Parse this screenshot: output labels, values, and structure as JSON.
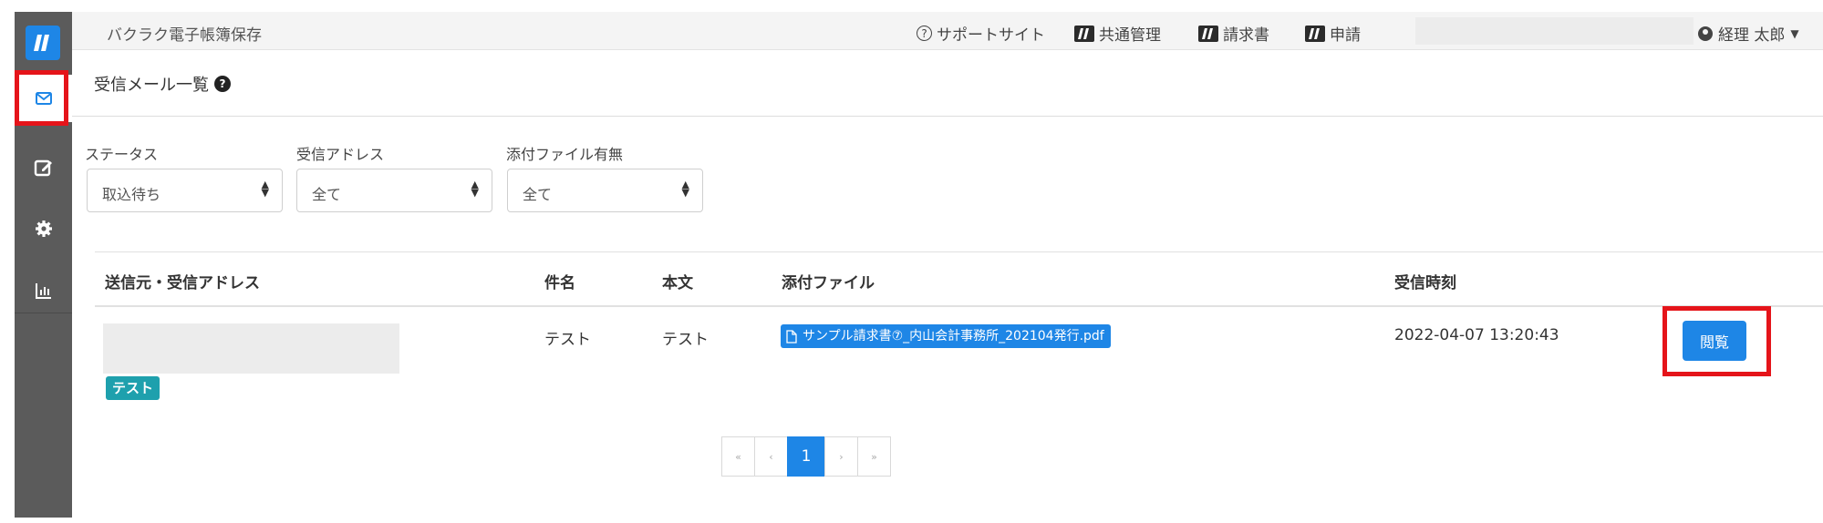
{
  "header": {
    "app_title": "バクラク電子帳簿保存",
    "links": [
      {
        "label": "サポートサイト"
      },
      {
        "label": "共通管理"
      },
      {
        "label": "請求書"
      },
      {
        "label": "申請"
      }
    ],
    "user_name": "経理 太郎"
  },
  "page": {
    "title": "受信メール一覧"
  },
  "filters": [
    {
      "label": "ステータス",
      "value": "取込待ち"
    },
    {
      "label": "受信アドレス",
      "value": "全て"
    },
    {
      "label": "添付ファイル有無",
      "value": "全て"
    }
  ],
  "table": {
    "columns": [
      "送信元・受信アドレス",
      "件名",
      "本文",
      "添付ファイル",
      "受信時刻"
    ],
    "rows": [
      {
        "tag": "テスト",
        "subject": "テスト",
        "body": "テスト",
        "attachment": "サンプル請求書⑦_内山会計事務所_202104発行.pdf",
        "received_at": "2022-04-07 13:20:43",
        "action_label": "閲覧"
      }
    ]
  },
  "pagination": {
    "first": "«",
    "prev": "‹",
    "current": "1",
    "next": "›",
    "last": "»"
  },
  "colors": {
    "accent": "#1e86e6",
    "sidebar": "#5b5b5b",
    "tag": "#1ea0ad",
    "highlight": "#e5141a"
  }
}
